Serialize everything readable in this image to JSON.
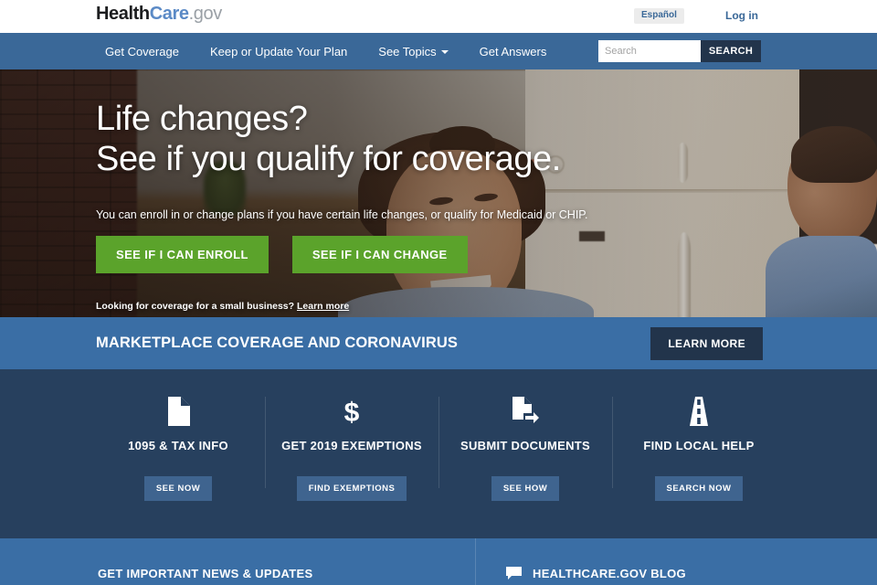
{
  "topbar": {
    "logo": {
      "part1": "Health",
      "part2": "Care",
      "part3": ".gov"
    },
    "espanol_label": "Español",
    "login_label": "Log in"
  },
  "nav": {
    "items": [
      {
        "label": "Get Coverage",
        "has_caret": false
      },
      {
        "label": "Keep or Update Your Plan",
        "has_caret": false
      },
      {
        "label": "See Topics",
        "has_caret": true
      },
      {
        "label": "Get Answers",
        "has_caret": false
      }
    ],
    "search": {
      "placeholder": "Search",
      "value": "",
      "button_label": "SEARCH"
    }
  },
  "hero": {
    "headline_line1": "Life changes?",
    "headline_line2": "See if you qualify for coverage.",
    "subtext": "You can enroll in or change plans if you have certain life changes, or qualify for Medicaid or CHIP.",
    "primary_button": "SEE IF I CAN ENROLL",
    "secondary_button": "SEE IF I CAN CHANGE",
    "small_text": "Looking for coverage for a small business?",
    "small_link": "Learn more"
  },
  "covid_banner": {
    "title": "MARKETPLACE COVERAGE AND CORONAVIRUS",
    "button_label": "LEARN MORE"
  },
  "quicklinks": [
    {
      "icon": "document-icon",
      "label": "1095 & TAX INFO",
      "button": "SEE NOW"
    },
    {
      "icon": "dollar-icon",
      "label": "GET 2019 EXEMPTIONS",
      "button": "FIND EXEMPTIONS"
    },
    {
      "icon": "document-upload-icon",
      "label": "SUBMIT DOCUMENTS",
      "button": "SEE HOW"
    },
    {
      "icon": "road-icon",
      "label": "FIND LOCAL HELP",
      "button": "SEARCH NOW"
    }
  ],
  "footer": {
    "news_title": "GET IMPORTANT NEWS & UPDATES",
    "blog_title": "HEALTHCARE.GOV BLOG",
    "blog_icon": "speech-bubble-icon"
  },
  "colors": {
    "nav_blue": "#3a6898",
    "banner_blue": "#3a6ea5",
    "dark_navy": "#27405e",
    "button_dark": "#22344b",
    "green": "#5ba32b",
    "link_blue": "#3a6898"
  }
}
